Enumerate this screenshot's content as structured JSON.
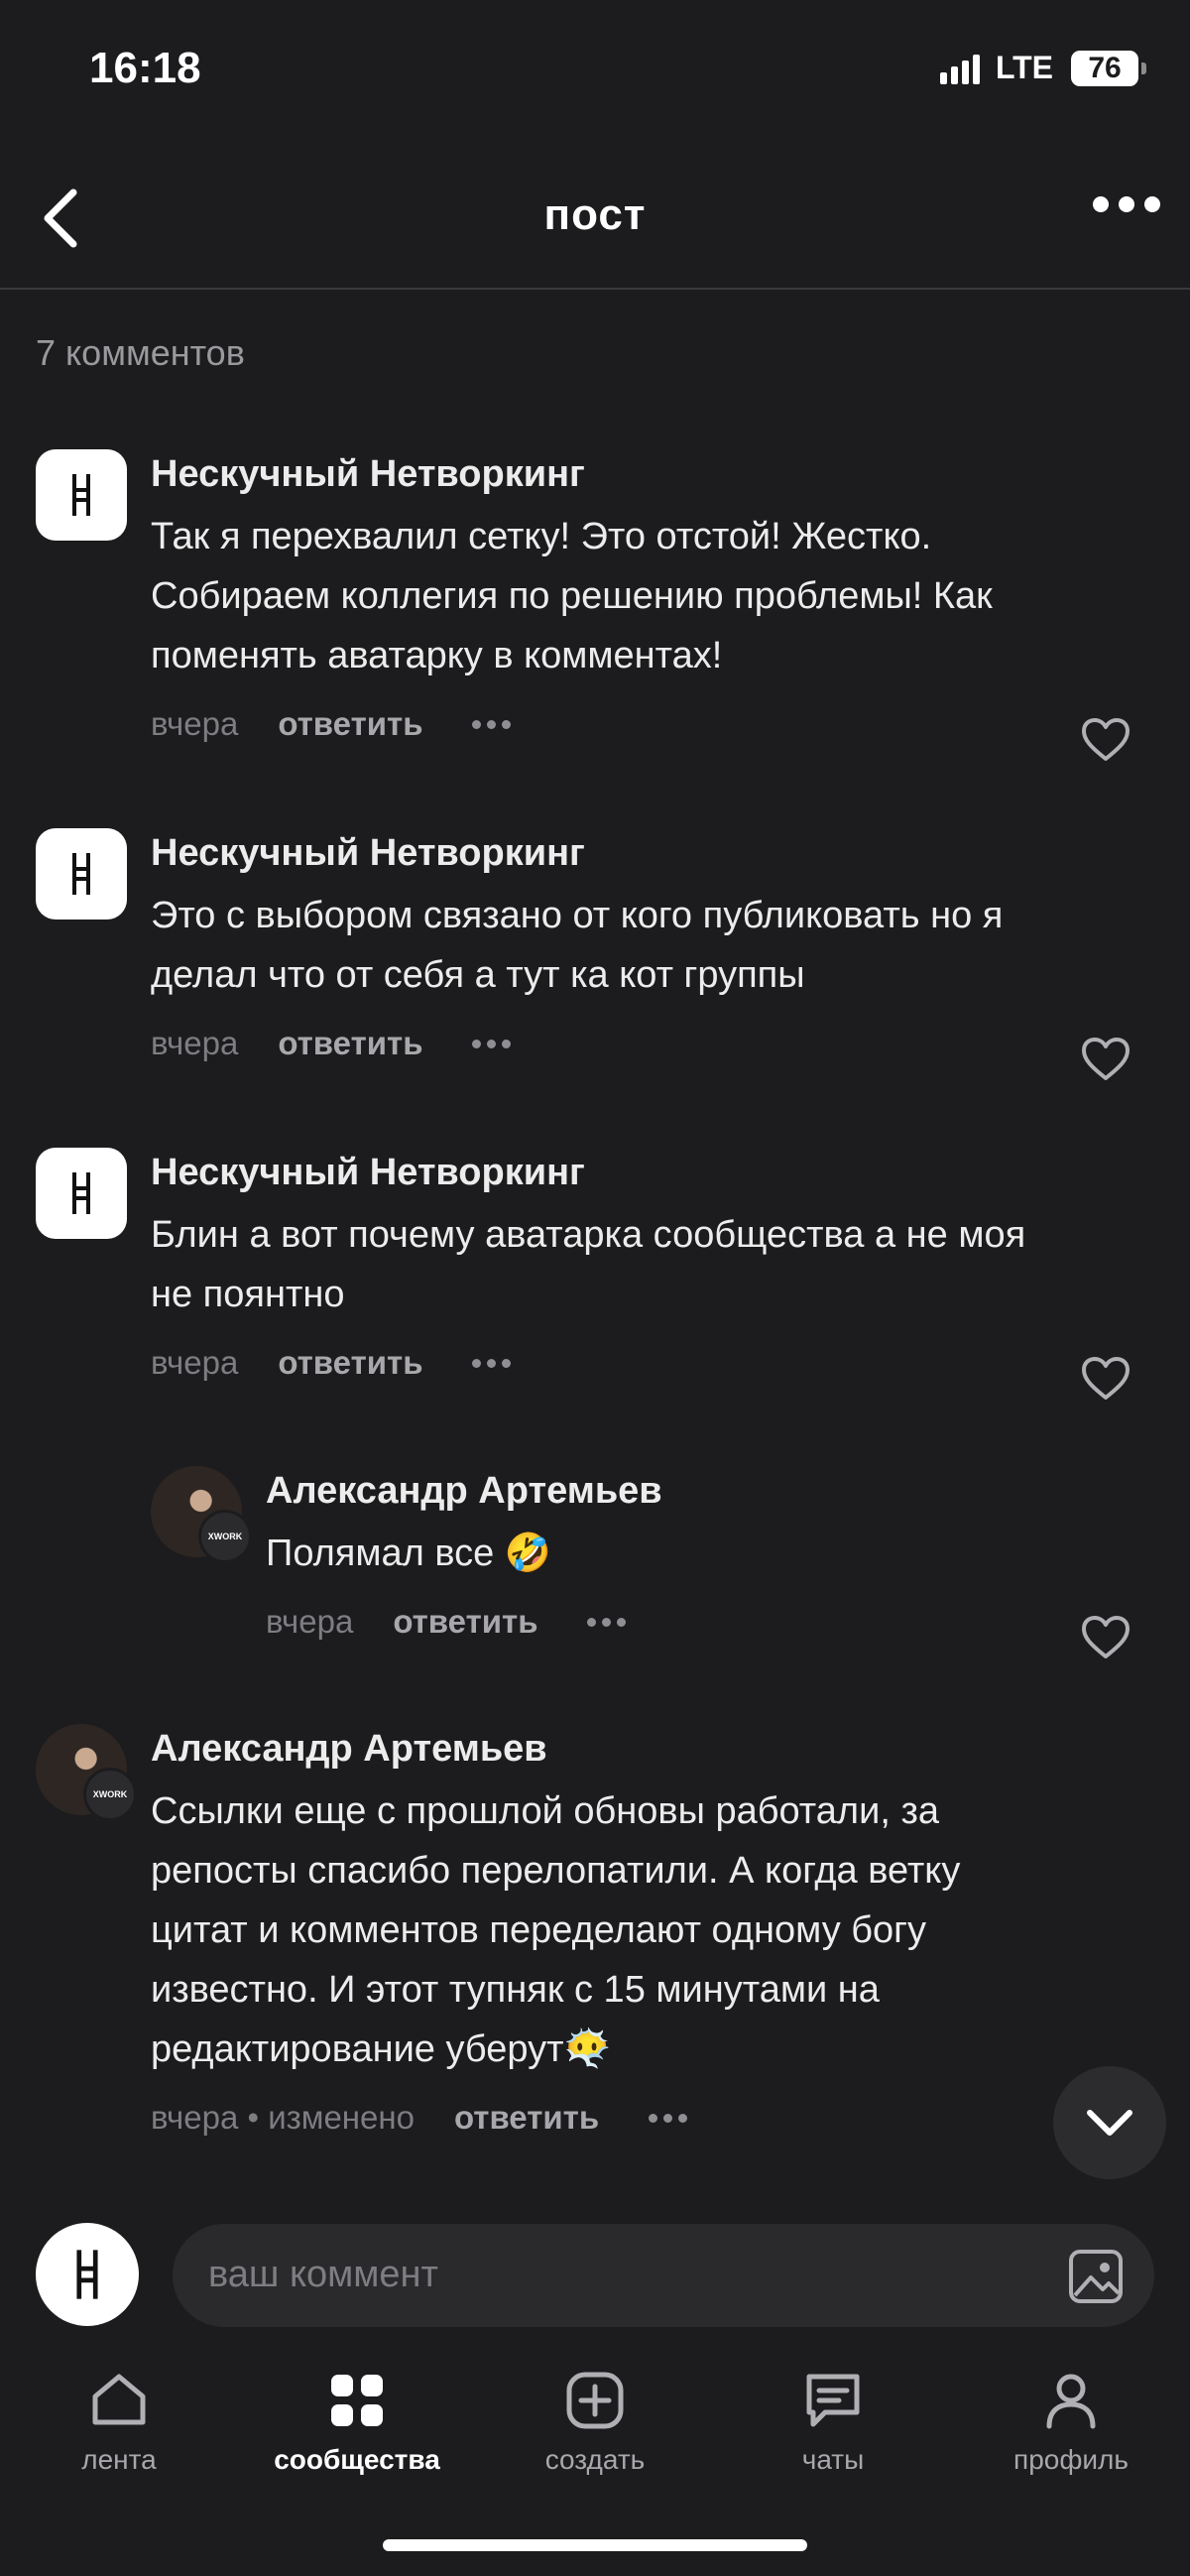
{
  "status": {
    "time": "16:18",
    "network": "LTE",
    "battery": "76"
  },
  "nav": {
    "title": "пост"
  },
  "comments_count": "7 комментов",
  "comments": [
    {
      "author": "Нескучный Нетворкинг",
      "lines": [
        "Так я перехвалил сетку! Это отстой! Жестко.",
        "Собираем коллегия по решению проблемы! Как",
        "поменять аватарку в комментах!"
      ],
      "time": "вчера",
      "reply": "ответить"
    },
    {
      "author": "Нескучный Нетворкинг",
      "lines": [
        "Это с выбором связано от кого публиковать но я",
        "делал что от себя а тут ка кот группы"
      ],
      "time": "вчера",
      "reply": "ответить"
    },
    {
      "author": "Нескучный Нетворкинг",
      "lines": [
        "Блин а вот почему аватарка сообщества а не моя",
        "не поянтно"
      ],
      "time": "вчера",
      "reply": "ответить"
    },
    {
      "author": "Александр Артемьев",
      "lines": [
        "Полямал все 🤣"
      ],
      "time": "вчера",
      "reply": "ответить",
      "badge": "XWORK"
    },
    {
      "author": "Александр Артемьев",
      "lines": [
        "Ссылки еще с прошлой обновы работали, за",
        "репосты спасибо перелопатили. А когда ветку",
        "цитат и комментов переделают одному богу",
        "известно. И этот тупняк с 15 минутами на",
        "редактирование уберут😶‍🌫️"
      ],
      "time": "вчера • изменено",
      "reply": "ответить",
      "badge": "XWORK"
    }
  ],
  "composer": {
    "placeholder": "ваш коммент"
  },
  "tabs": [
    {
      "label": "лента",
      "icon": "home-icon"
    },
    {
      "label": "сообщества",
      "icon": "grid-icon"
    },
    {
      "label": "создать",
      "icon": "plus-square-icon"
    },
    {
      "label": "чаты",
      "icon": "chat-icon"
    },
    {
      "label": "профиль",
      "icon": "user-icon"
    }
  ],
  "colors": {
    "background": "#1c1c1e",
    "text": "#ececec",
    "muted": "#7d7d82",
    "input": "#2a2a2c"
  }
}
